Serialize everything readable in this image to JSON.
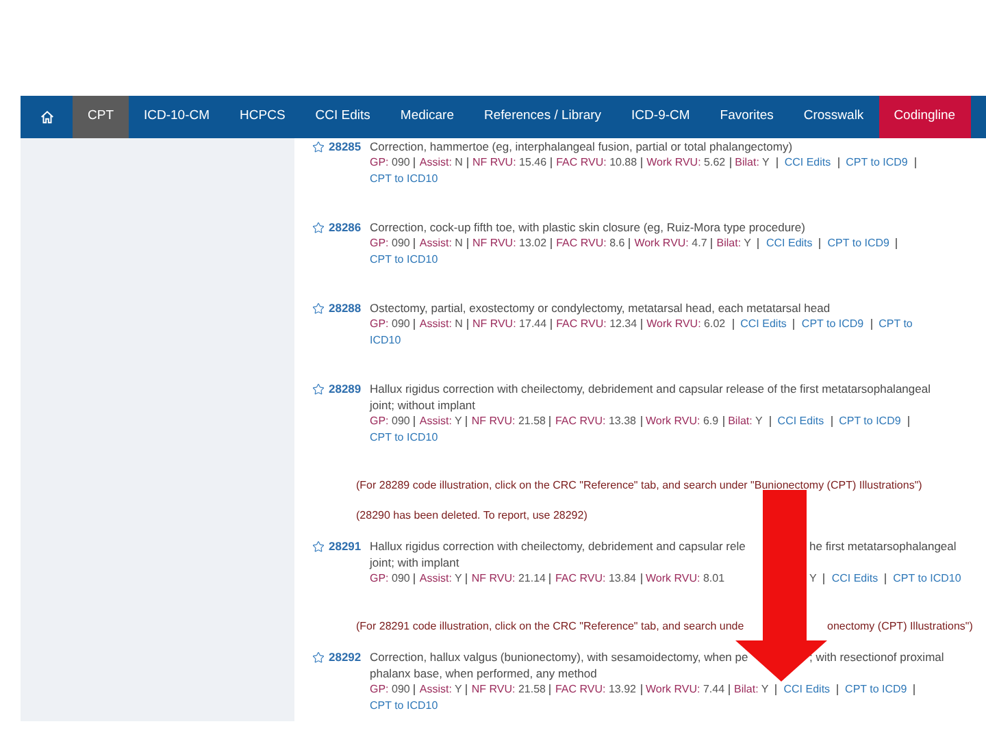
{
  "nav": {
    "items": [
      {
        "kind": "home",
        "selected": false
      },
      {
        "kind": "tab",
        "label": "CPT",
        "selected": true
      },
      {
        "kind": "tab",
        "label": "ICD-10-CM",
        "selected": false
      },
      {
        "kind": "tab",
        "label": "HCPCS",
        "selected": false
      },
      {
        "kind": "tab",
        "label": "CCI Edits",
        "selected": false
      },
      {
        "kind": "tab",
        "label": "Medicare",
        "selected": false
      },
      {
        "kind": "tab",
        "label": "References / Library",
        "selected": false
      },
      {
        "kind": "tab",
        "label": "ICD-9-CM",
        "selected": false
      },
      {
        "kind": "tab",
        "label": "Favorites",
        "selected": false
      },
      {
        "kind": "tab",
        "label": "Crosswalk",
        "selected": false
      },
      {
        "kind": "tab",
        "label": "Codingline",
        "selected": false,
        "color": "#c8103c"
      }
    ]
  },
  "entries": [
    {
      "kind": "code",
      "code": "28285",
      "description": [
        [
          "Correction, hammertoe (eg, interphalangeal fusion, partial or total phalangectomy)"
        ]
      ],
      "meta": [
        [
          {
            "kind": "field",
            "label": "GP:",
            "value": "090"
          },
          {
            "kind": "sep"
          },
          {
            "kind": "field",
            "label": "Assist:",
            "value": "N"
          },
          {
            "kind": "sep"
          },
          {
            "kind": "field",
            "label": "NF RVU:",
            "value": "15.46"
          },
          {
            "kind": "sep"
          },
          {
            "kind": "field",
            "label": "FAC RVU:",
            "value": "10.88"
          },
          {
            "kind": "sep"
          },
          {
            "kind": "field",
            "label": "Work RVU:",
            "value": "5.62"
          },
          {
            "kind": "sep"
          },
          {
            "kind": "field",
            "label": "Bilat:",
            "value": "Y"
          },
          {
            "kind": "sep"
          },
          {
            "kind": "link",
            "text": "CCI Edits"
          },
          {
            "kind": "sep"
          },
          {
            "kind": "link",
            "text": "CPT to ICD9"
          },
          {
            "kind": "sep"
          }
        ],
        [
          {
            "kind": "link",
            "text": "CPT to ICD10"
          }
        ]
      ]
    },
    {
      "kind": "code",
      "code": "28286",
      "description": [
        [
          "Correction, cock-up fifth toe, with plastic skin closure (eg, Ruiz-Mora type procedure)"
        ]
      ],
      "meta": [
        [
          {
            "kind": "field",
            "label": "GP:",
            "value": "090"
          },
          {
            "kind": "sep"
          },
          {
            "kind": "field",
            "label": "Assist:",
            "value": "N"
          },
          {
            "kind": "sep"
          },
          {
            "kind": "field",
            "label": "NF RVU:",
            "value": "13.02"
          },
          {
            "kind": "sep"
          },
          {
            "kind": "field",
            "label": "FAC RVU:",
            "value": "8.6"
          },
          {
            "kind": "sep"
          },
          {
            "kind": "field",
            "label": "Work RVU:",
            "value": "4.7"
          },
          {
            "kind": "sep"
          },
          {
            "kind": "field",
            "label": "Bilat:",
            "value": "Y"
          },
          {
            "kind": "sep"
          },
          {
            "kind": "link",
            "text": "CCI Edits"
          },
          {
            "kind": "sep"
          },
          {
            "kind": "link",
            "text": "CPT to ICD9"
          },
          {
            "kind": "sep"
          }
        ],
        [
          {
            "kind": "link",
            "text": "CPT to ICD10"
          }
        ]
      ]
    },
    {
      "kind": "code",
      "code": "28288",
      "description": [
        [
          "Ostectomy, partial, exostectomy or condylectomy, metatarsal head, each metatarsal head"
        ]
      ],
      "meta": [
        [
          {
            "kind": "field",
            "label": "GP:",
            "value": "090"
          },
          {
            "kind": "sep"
          },
          {
            "kind": "field",
            "label": "Assist:",
            "value": "N"
          },
          {
            "kind": "sep"
          },
          {
            "kind": "field",
            "label": "NF RVU:",
            "value": "17.44"
          },
          {
            "kind": "sep"
          },
          {
            "kind": "field",
            "label": "FAC RVU:",
            "value": "12.34"
          },
          {
            "kind": "sep"
          },
          {
            "kind": "field",
            "label": "Work RVU:",
            "value": "6.02"
          },
          {
            "kind": "sep"
          },
          {
            "kind": "link",
            "text": "CCI Edits"
          },
          {
            "kind": "sep"
          },
          {
            "kind": "link",
            "text": "CPT to ICD9"
          },
          {
            "kind": "sep"
          },
          {
            "kind": "link",
            "text": "CPT to"
          }
        ],
        [
          {
            "kind": "link",
            "text": "ICD10"
          }
        ]
      ]
    },
    {
      "kind": "code",
      "code": "28289",
      "description": [
        [
          "Hallux rigidus correction with cheilectomy, debridement and capsular release of the first metatarsophalangeal"
        ],
        [
          "joint; without implant"
        ]
      ],
      "meta": [
        [
          {
            "kind": "field",
            "label": "GP:",
            "value": "090"
          },
          {
            "kind": "sep"
          },
          {
            "kind": "field",
            "label": "Assist:",
            "value": "Y"
          },
          {
            "kind": "sep"
          },
          {
            "kind": "field",
            "label": "NF RVU:",
            "value": "21.58"
          },
          {
            "kind": "sep"
          },
          {
            "kind": "field",
            "label": "FAC RVU:",
            "value": "13.38"
          },
          {
            "kind": "sep"
          },
          {
            "kind": "field",
            "label": "Work RVU:",
            "value": "6.9"
          },
          {
            "kind": "sep"
          },
          {
            "kind": "field",
            "label": "Bilat:",
            "value": "Y"
          },
          {
            "kind": "sep"
          },
          {
            "kind": "link",
            "text": "CCI Edits"
          },
          {
            "kind": "sep"
          },
          {
            "kind": "link",
            "text": "CPT to ICD9"
          },
          {
            "kind": "sep"
          }
        ],
        [
          {
            "kind": "link",
            "text": "CPT to ICD10"
          }
        ]
      ]
    },
    {
      "kind": "note",
      "lines": [
        [
          "(For 28289 code illustration, click on the CRC \"Reference\" tab, and search under \"Bunionectomy (CPT) Illustrations\")"
        ]
      ]
    },
    {
      "kind": "note",
      "lines": [
        [
          "(28290 has been deleted.  To report, use 28292)"
        ]
      ]
    },
    {
      "kind": "code",
      "code": "28291",
      "description": [
        [
          "Hallux rigidus correction with cheilectomy, debridement and capsular rele",
          "he first metatarsophalangeal"
        ],
        [
          "joint; with implant"
        ]
      ],
      "meta": [
        [
          {
            "kind": "field",
            "label": "GP:",
            "value": "090"
          },
          {
            "kind": "sep"
          },
          {
            "kind": "field",
            "label": "Assist:",
            "value": "Y"
          },
          {
            "kind": "sep"
          },
          {
            "kind": "field",
            "label": "NF RVU:",
            "value": "21.14"
          },
          {
            "kind": "sep"
          },
          {
            "kind": "field",
            "label": "FAC RVU:",
            "value": "13.84"
          },
          {
            "kind": "sep"
          },
          {
            "kind": "field",
            "label": "Work RVU:",
            "value": "8.01"
          },
          {
            "kind": "gap"
          },
          {
            "kind": "field",
            "value": "Y"
          },
          {
            "kind": "sep"
          },
          {
            "kind": "link",
            "text": "CCI Edits"
          },
          {
            "kind": "sep"
          },
          {
            "kind": "link",
            "text": "CPT to ICD10"
          }
        ]
      ]
    },
    {
      "kind": "note",
      "lines": [
        [
          "(For 28291 code illustration, click on the CRC \"Reference\" tab, and search unde",
          "onectomy (CPT) Illustrations\")"
        ]
      ]
    },
    {
      "kind": "code",
      "code": "28292",
      "description": [
        [
          "Correction, hallux valgus (bunionectomy), with sesamoidectomy, when pe",
          "; with resectionof proximal"
        ],
        [
          "phalanx base, when performed, any method"
        ]
      ],
      "meta": [
        [
          {
            "kind": "field",
            "label": "GP:",
            "value": "090"
          },
          {
            "kind": "sep"
          },
          {
            "kind": "field",
            "label": "Assist:",
            "value": "Y"
          },
          {
            "kind": "sep"
          },
          {
            "kind": "field",
            "label": "NF RVU:",
            "value": "21.58"
          },
          {
            "kind": "sep"
          },
          {
            "kind": "field",
            "label": "FAC RVU:",
            "value": "13.92"
          },
          {
            "kind": "sep"
          },
          {
            "kind": "field",
            "label": "Work RVU:",
            "value": "7.44"
          },
          {
            "kind": "sep"
          },
          {
            "kind": "field",
            "label": "Bilat:",
            "value": "Y"
          },
          {
            "kind": "sep"
          },
          {
            "kind": "link",
            "text": "CCI Edits"
          },
          {
            "kind": "sep"
          },
          {
            "kind": "link",
            "text": "CPT to ICD9"
          },
          {
            "kind": "sep"
          }
        ],
        [
          {
            "kind": "link",
            "text": "CPT to ICD10"
          }
        ]
      ]
    }
  ]
}
